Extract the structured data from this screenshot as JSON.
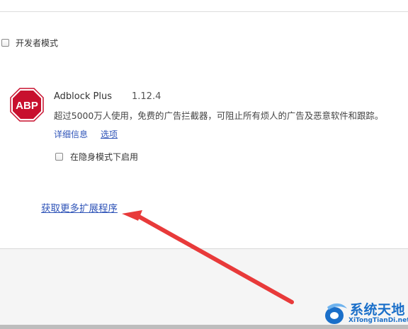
{
  "developer_mode": {
    "label": "开发者模式",
    "checked": false
  },
  "extension": {
    "icon_text": "ABP",
    "name": "Adblock Plus",
    "version": "1.12.4",
    "description": "超过5000万人使用，免费的广告拦截器，可阻止所有烦人的广告及恶意软件和跟踪。",
    "details_link": "详细信息",
    "options_link": "选项",
    "incognito": {
      "label": "在隐身模式下启用",
      "checked": false
    }
  },
  "get_more_link": "获取更多扩展程序",
  "watermark": {
    "title": "系统天地",
    "subtitle": "XiTongTianDi.net"
  },
  "colors": {
    "link": "#2f54b8",
    "abp_red": "#c8102e",
    "annotation_arrow": "#e83a3a",
    "watermark_blue": "#1a6fc9"
  }
}
